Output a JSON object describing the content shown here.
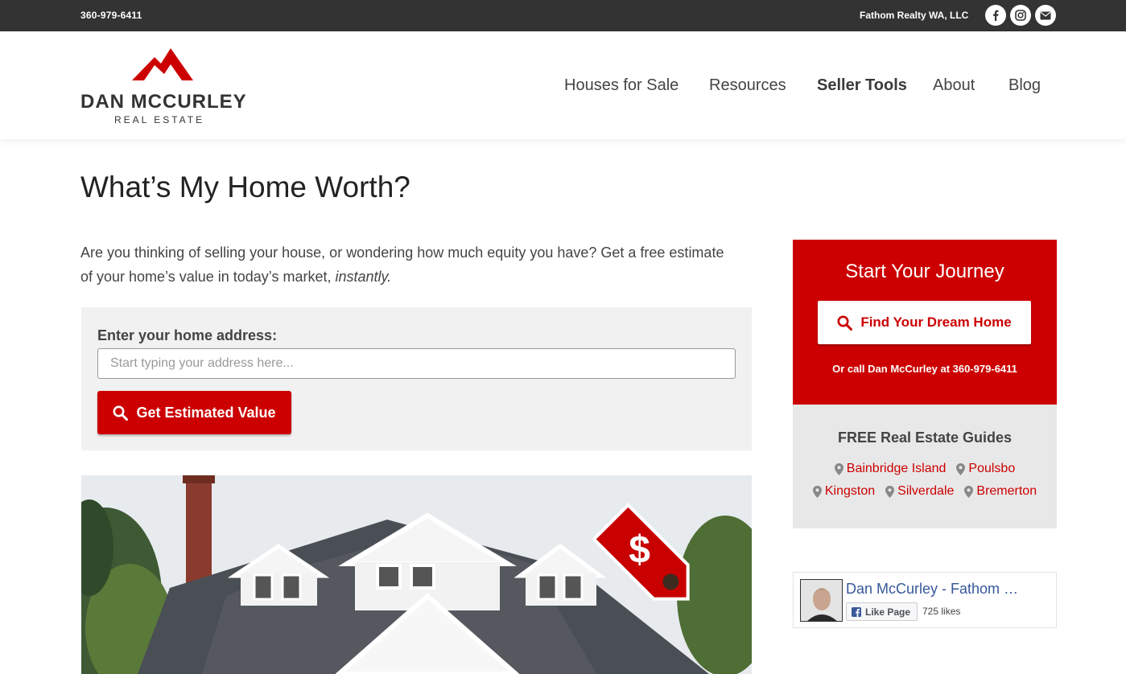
{
  "topbar": {
    "phone": "360-979-6411",
    "brokerage": "Fathom Realty WA, LLC",
    "social_icons": [
      "facebook-icon",
      "instagram-icon",
      "email-icon"
    ]
  },
  "logo": {
    "name": "DAN MCCURLEY",
    "subtitle": "REAL ESTATE"
  },
  "nav": {
    "items": [
      {
        "label": "Houses for Sale"
      },
      {
        "label": "Resources"
      },
      {
        "label": "Seller Tools"
      },
      {
        "label": "About"
      },
      {
        "label": "Blog"
      }
    ]
  },
  "page": {
    "title": "What’s My Home Worth?",
    "intro": "Are you thinking of selling your house, or wondering how much equity you have? Get a free estimate of your home’s value in today’s market,",
    "intro_emphasis": "instantly."
  },
  "estimate": {
    "label": "Enter your home address:",
    "placeholder": "Start typing your address here...",
    "value": "",
    "button_label": "Get Estimated Value"
  },
  "sidebar": {
    "journey": {
      "heading": "Start Your Journey",
      "button_label": "Find Your Dream Home",
      "call_prefix": "Or call Dan McCurley at",
      "call_phone": "360-979-6411"
    },
    "guides": {
      "heading": "FREE Real Estate Guides",
      "row1": [
        "Bainbridge Island",
        "Poulsbo"
      ],
      "row2": [
        "Kingston",
        "Silverdale",
        "Bremerton"
      ]
    },
    "facebook": {
      "page_name": "Dan McCurley - Fathom …",
      "like_label": "Like Page",
      "likes": "725 likes"
    }
  },
  "colors": {
    "accent": "#cc0000",
    "topbar": "#333333",
    "panel": "#f1f1f1"
  }
}
